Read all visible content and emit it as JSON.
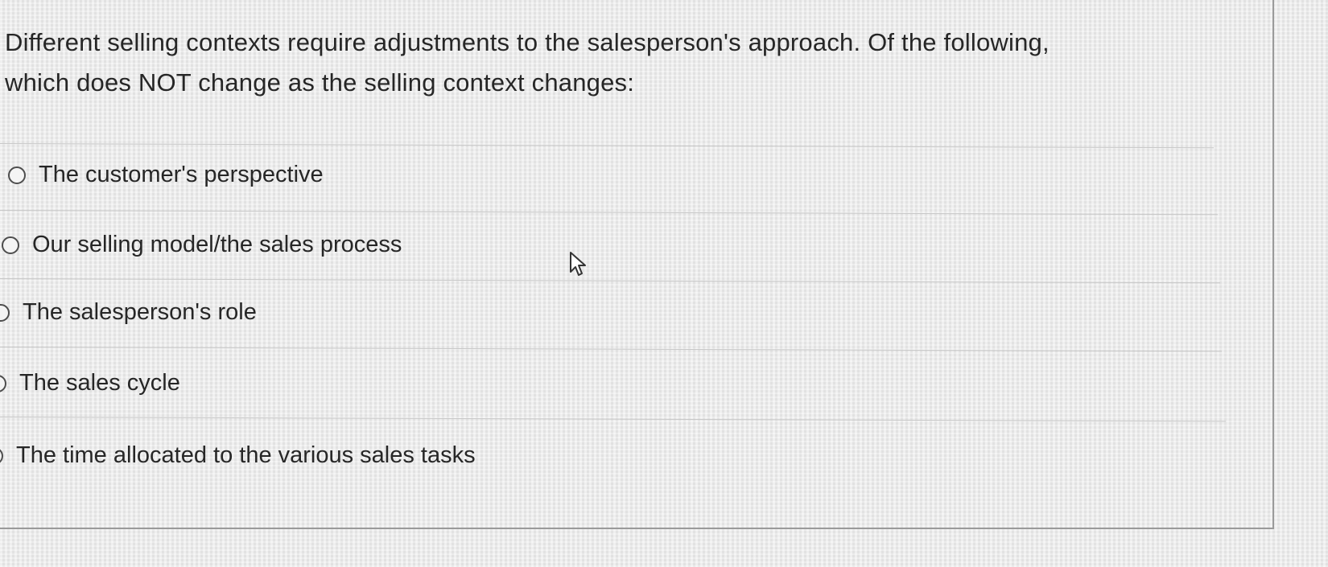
{
  "question": {
    "line1": "Different selling contexts require adjustments to the salesperson's approach. Of the following,",
    "line2": "which does NOT change as the selling context changes:"
  },
  "options": [
    {
      "label": "The customer's perspective",
      "selected": false
    },
    {
      "label": "Our selling model/the sales process",
      "selected": false
    },
    {
      "label": "The salesperson's role",
      "selected": false
    },
    {
      "label": "The sales cycle",
      "selected": false
    },
    {
      "label": "The time allocated to the various sales tasks",
      "selected": false
    }
  ],
  "colors": {
    "background": "#ebebeb",
    "text": "#262626",
    "divider": "#c8c8c8",
    "radio_border": "#4d4d4d"
  },
  "icons": {
    "cursor": "mouse-pointer-icon",
    "radio": "radio-circle-icon"
  }
}
